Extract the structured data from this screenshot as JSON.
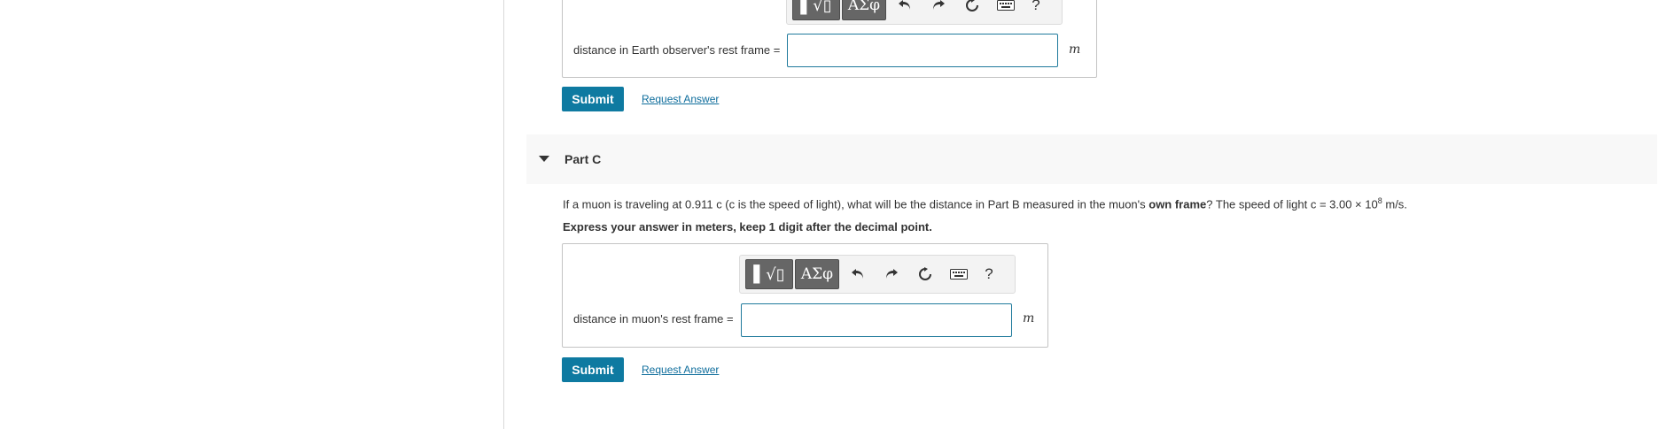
{
  "part_b": {
    "field_label": "distance in Earth observer's rest frame =",
    "input_value": "",
    "unit": "m",
    "toolbar": {
      "templates_label": "▌√▯",
      "symbols_label": "ΑΣφ",
      "help_label": "?"
    },
    "submit_label": "Submit",
    "request_answer_label": "Request Answer"
  },
  "part_c": {
    "title": "Part C",
    "question": {
      "before_bold": "If a muon is traveling at 0.911 c (c is the speed of light), what will be the distance in Part B measured in the muon's ",
      "bold": "own frame",
      "after_bold": "? The speed of light c = 3.00 × 10",
      "exponent": "8",
      "tail": " m/s."
    },
    "instruction": "Express your answer in meters, keep 1 digit after the decimal point.",
    "toolbar": {
      "templates_label": "▌√▯",
      "symbols_label": "ΑΣφ",
      "help_label": "?"
    },
    "field_label": "distance in muon's rest frame =",
    "input_value": "",
    "unit": "m",
    "submit_label": "Submit",
    "request_answer_label": "Request Answer"
  },
  "icons": [
    "undo-icon",
    "redo-icon",
    "reset-icon",
    "keyboard-icon",
    "collapse-caret-icon"
  ]
}
